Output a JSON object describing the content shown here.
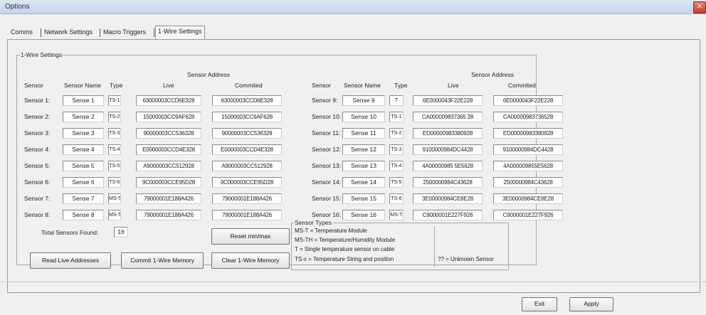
{
  "window": {
    "title": "Options",
    "close_glyph": "✕"
  },
  "tabs": [
    "Comms",
    "Network Settings",
    "Macro Triggers",
    "1-Wire Settings"
  ],
  "group": {
    "title": "1-Wire Settings"
  },
  "headers": {
    "sensor": "Sensor",
    "sensor_name": "Sensor Name",
    "type": "Type",
    "sensor_address": "Sensor Address",
    "live": "Live",
    "committed": "Commited"
  },
  "sensors": [
    {
      "label": "Sensor 1:",
      "name": "Sense 1",
      "type": "TS-1",
      "live": "63000003CCD6E328",
      "committed": "63000003CCD6E328"
    },
    {
      "label": "Sensor 2:",
      "name": "Sense 2",
      "type": "TS-2",
      "live": "15000003CC9AF628",
      "committed": "15000003CC9AF628"
    },
    {
      "label": "Sensor 3:",
      "name": "Sense 3",
      "type": "TS-3",
      "live": "90000003CC536328",
      "committed": "90000003CC536328"
    },
    {
      "label": "Sensor 4:",
      "name": "Sense 4",
      "type": "TS-4",
      "live": "E0000003CCD4E328",
      "committed": "E0000003CCD4E328"
    },
    {
      "label": "Sensor 5:",
      "name": "Sense 5",
      "type": "TS-5",
      "live": "A9000003CC512928",
      "committed": "A9000003CC512928"
    },
    {
      "label": "Sensor 6:",
      "name": "Sense 6",
      "type": "TS-6",
      "live": "9C000003CCE95D28",
      "committed": "9C000003CCE95D28"
    },
    {
      "label": "Sensor 7:",
      "name": "Sense 7",
      "type": "MS-TH",
      "live": "79000001E188A426",
      "committed": "79000001E188A426"
    },
    {
      "label": "Sensor 8:",
      "name": "Sense 8",
      "type": "MS-TH",
      "live": "79000001E188A426",
      "committed": "79000001E188A426"
    },
    {
      "label": "Sensor 9:",
      "name": "Sense 9",
      "type": "T",
      "live": "6E0000043F22E228",
      "committed": "6E0000043F22E228"
    },
    {
      "label": "Sensor 10:",
      "name": "Sense 10",
      "type": "TS-1",
      "live": "CA000009837365 28",
      "committed": "CA00000983736528"
    },
    {
      "label": "Sensor 11:",
      "name": "Sense 11",
      "type": "TS-2",
      "live": "ED00000983380928",
      "committed": "ED00000983380928"
    },
    {
      "label": "Sensor 12:",
      "name": "Sense 12",
      "type": "TS-3",
      "live": "9100000984DC4428",
      "committed": "9100000984DC4428"
    },
    {
      "label": "Sensor 13:",
      "name": "Sense 13",
      "type": "TS-4",
      "live": "4A00000985 5E5628",
      "committed": "4A000009855E5628"
    },
    {
      "label": "Sensor 14:",
      "name": "Sense 14",
      "type": "TS-5",
      "live": "2500000984C43628",
      "committed": "2500000984C43628"
    },
    {
      "label": "Sensor 15:",
      "name": "Sense 15",
      "type": "TS-6",
      "live": "3E00000984CE8E28",
      "committed": "3E00000984CE8E28"
    },
    {
      "label": "Sensor 16:",
      "name": "Sense 16",
      "type": "MS-T",
      "live": "C9000001E227F926",
      "committed": "C9000001E227F926"
    }
  ],
  "total": {
    "label": "Total Sensors Found:",
    "value": "16"
  },
  "buttons": {
    "reset": "Reset min/max",
    "read_live": "Read Live Addresses",
    "commit": "Commit 1-Wire Memory",
    "clear": "Clear 1-Wire Memory",
    "exit": "Exit",
    "apply": "Apply"
  },
  "sensor_types": {
    "title": "Sensor Types",
    "lines": [
      "MS-T = Temperature Module",
      "MS-TH = Temperature/Humidity Module",
      "T = Single temperature sensor on cable",
      "TS-x = Temperature String and position"
    ],
    "unknown": "?? = Unknown Sensor"
  }
}
